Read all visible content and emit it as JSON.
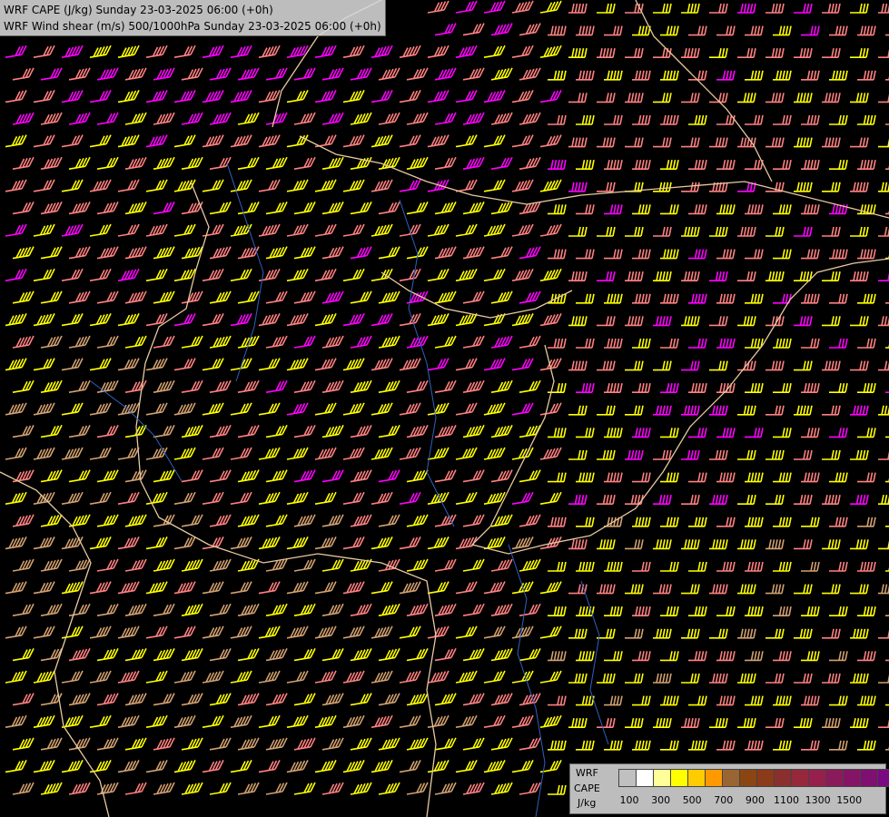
{
  "title_lines": [
    "WRF CAPE (J/kg) Sunday 23-03-2025 06:00 (+0h)",
    "WRF Wind shear (m/s) 500/1000hPa Sunday 23-03-2025 06:00 (+0h)"
  ],
  "legend": {
    "labels": [
      "WRF",
      "CAPE",
      "J/kg"
    ],
    "colors": [
      "#c0c0c0",
      "#ffffff",
      "#ffff99",
      "#ffff00",
      "#ffcc00",
      "#ff9900",
      "#996633",
      "#8b4513",
      "#8b3a1a",
      "#8b2e2e",
      "#96283c",
      "#96204b",
      "#8b1a5a",
      "#851466",
      "#800f72",
      "#7a0a80"
    ],
    "ticks": [
      "100",
      "300",
      "500",
      "700",
      "900",
      "1100",
      "1300",
      "1500"
    ]
  },
  "map_colors": {
    "background": "#000000",
    "border": "#e8c9a0",
    "river": "#3060c0",
    "barb_yellow": "#ffff00",
    "barb_salmon": "#ff8080",
    "barb_magenta": "#ff00ff",
    "barb_tan": "#d2a070"
  }
}
